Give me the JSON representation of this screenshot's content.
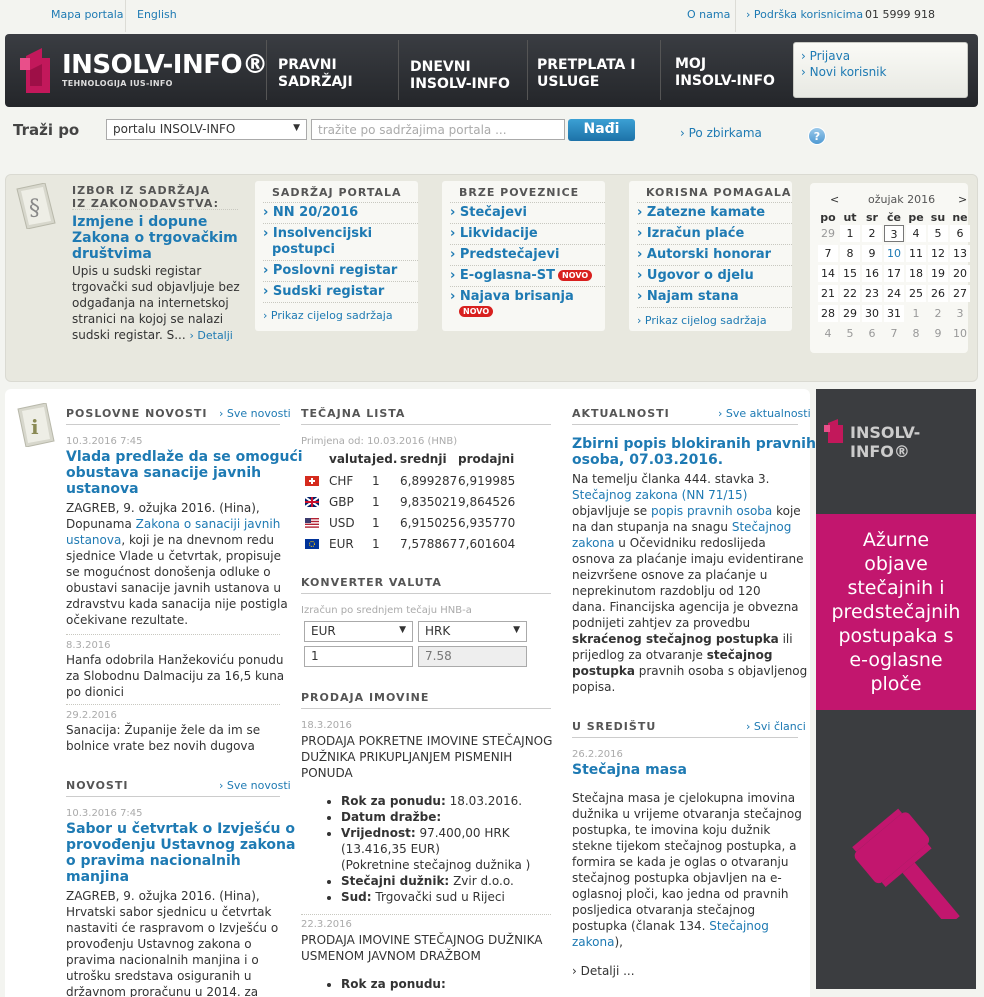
{
  "topbar": {
    "map": "Mapa portala",
    "english": "English",
    "about": "O nama",
    "support": "› Podrška korisnicima",
    "phone": "01 5999 918"
  },
  "logo": {
    "name": "INSOLV-INFO®",
    "tagline": "TEHNOLOGIJA IUS-INFO"
  },
  "nav": [
    [
      "PRAVNI",
      "SADRŽAJI"
    ],
    [
      "DNEVNI",
      "INSOLV-INFO"
    ],
    [
      "PRETPLATA I",
      "USLUGE"
    ],
    [
      "MOJ",
      "INSOLV-INFO"
    ]
  ],
  "login": {
    "signin": "› Prijava",
    "new_user": "› Novi korisnik"
  },
  "search": {
    "label": "Traži po",
    "scope": "portalu INSOLV-INFO",
    "placeholder": "tražite po sadržajima portala ...",
    "button": "Nađi",
    "collections": "› Po zbirkama",
    "help": "?"
  },
  "featured": {
    "head1": "IZBOR IZ SADRŽAJA",
    "head2": "IZ ZAKONODAVSTVA:",
    "title": [
      "Izmjene i dopune",
      "Zakona o trgovačkim",
      "društvima"
    ],
    "text": [
      "Upis u sudski registar",
      "trgovački sud objavljuje bez",
      "odgađanja na internetskoj",
      "stranici na kojoj se nalazi",
      "sudski registar. S..."
    ],
    "more": "› Detalji"
  },
  "portal": {
    "head": "SADRŽAJ PORTALA",
    "items": [
      "NN 20/2016",
      "Insolvencijski",
      "postupci",
      "Poslovni registar",
      "Sudski registar"
    ],
    "all": "› Prikaz cijelog sadržaja"
  },
  "quick": {
    "head": "BRZE POVEZNICE",
    "items": [
      "Stečajevi",
      "Likvidacije",
      "Predstečajevi",
      "E-oglasna-ST",
      "Najava brisanja"
    ],
    "novo": "NOVO"
  },
  "tools": {
    "head": "KORISNA POMAGALA",
    "items": [
      "Zatezne kamate",
      "Izračun plaće",
      "Autorski honorar",
      "Ugovor o djelu",
      "Najam stana"
    ],
    "all": "› Prikaz cijelog sadržaja"
  },
  "calendar": {
    "prev": "<",
    "month": "ožujak",
    "year": "2016",
    "next": ">",
    "days": [
      "po",
      "ut",
      "sr",
      "če",
      "pe",
      "su",
      "ne"
    ],
    "weeks": [
      [
        "29",
        "1",
        "2",
        "3",
        "4",
        "5",
        "6"
      ],
      [
        "7",
        "8",
        "9",
        "10",
        "11",
        "12",
        "13"
      ],
      [
        "14",
        "15",
        "16",
        "17",
        "18",
        "19",
        "20"
      ],
      [
        "21",
        "22",
        "23",
        "24",
        "25",
        "26",
        "27"
      ],
      [
        "28",
        "29",
        "30",
        "31",
        "1",
        "2",
        "3"
      ],
      [
        "4",
        "5",
        "6",
        "7",
        "8",
        "9",
        "10"
      ]
    ]
  },
  "business": {
    "head": "POSLOVNE NOVOSTI",
    "all": "› Sve novosti",
    "n1": {
      "date": "10.3.2016 7:45",
      "title": [
        "Vlada predlaže da se omogući",
        "obustava sanacije javnih",
        "ustanova"
      ],
      "text": [
        "ZAGREB, 9. ožujka 2016. (Hina),",
        "Dopunama ",
        "Zakona o sanaciji javnih",
        "ustanova",
        ", koji je na dnevnom redu",
        "sjednice Vlade u četvrtak, propisuje",
        "se mogućnost donošenja odluke o",
        "obustavi sanacije javnih ustanova u",
        "zdravstvu kada sanacija nije postigla",
        "očekivane rezultate."
      ]
    },
    "n2": {
      "date": "8.3.2016",
      "title": [
        "Hanfa odobrila Hanžekoviću ponudu",
        "za Slobodnu Dalmaciju za 16,5 kuna",
        "po dionici"
      ]
    },
    "n3": {
      "date": "29.2.2016",
      "title": [
        "Sanacija: Županije žele da im se",
        "bolnice vrate bez novih dugova"
      ]
    }
  },
  "news": {
    "head": "NOVOSTI",
    "all": "› Sve novosti",
    "n1": {
      "date": "10.3.2016 7:45",
      "title": [
        "Sabor u četvrtak o Izvješću o",
        "provođenju Ustavnog zakona",
        "o pravima nacionalnih",
        "manjina"
      ],
      "text": [
        "ZAGREB, 9. ožujka 2016. (Hina),",
        "Hrvatski sabor sjednicu u četvrtak",
        "nastaviti će raspravom o Izvješću o",
        "provođenju Ustavnog zakona o",
        "pravima nacionalnih manjina i o",
        "utrošku sredstava osiguranih u",
        "državnom proračunu u 2014. za"
      ]
    }
  },
  "rates": {
    "head": "TEČAJNA LISTA",
    "applies": "Primjena od: 10.03.2016 (HNB)",
    "cols": [
      "valuta",
      "jed.",
      "srednji",
      "prodajni"
    ],
    "rows": [
      [
        "CHF",
        "1",
        "6,899287",
        "6,919985"
      ],
      [
        "GBP",
        "1",
        "9,835021",
        "9,864526"
      ],
      [
        "USD",
        "1",
        "6,915025",
        "6,935770"
      ],
      [
        "EUR",
        "1",
        "7,578867",
        "7,601604"
      ]
    ]
  },
  "converter": {
    "head": "KONVERTER VALUTA",
    "note": "Izračun po srednjem tečaju HNB-a",
    "from": "EUR",
    "to": "HRK",
    "amount": "1",
    "result": "7.58"
  },
  "sales": {
    "head": "PRODAJA IMOVINE",
    "s1": {
      "date": "18.3.2016",
      "title": [
        "PRODAJA POKRETNE IMOVINE STEČAJNOG",
        "DUŽNIKA PRIKUPLJANJEM PISMENIH",
        "PONUDA"
      ],
      "deadline_label": "Rok za ponudu:",
      "deadline": "18.03.2016.",
      "date_label": "Datum dražbe:",
      "value_label": "Vrijednost:",
      "value": "97.400,00 HRK",
      "value2": "(13.416,35 EUR)",
      "value3": "(Pokretnine stečajnog dužnika )",
      "debtor_label": "Stečajni dužnik:",
      "debtor": "Zvir d.o.o.",
      "court_label": "Sud:",
      "court": "Trgovački sud u Rijeci"
    },
    "s2": {
      "date": "22.3.2016",
      "title": [
        "PRODAJA IMOVINE STEČAJNOG DUŽNIKA",
        "USMENOM JAVNOM DRAŽBOM"
      ],
      "deadline_label": "Rok za ponudu:"
    }
  },
  "actual": {
    "head": "AKTUALNOSTI",
    "all": "› Sve aktualnosti",
    "title": [
      "Zbirni popis blokiranih pravnih",
      "osoba, 07.03.2016."
    ],
    "lines": [
      "Na temelju članka 444. stavka 3.",
      "Stečajnog zakona (NN 71/15)",
      "objavljuje se ",
      "popis pravnih osoba",
      " koje",
      "na dan stupanja na snagu ",
      "Stečajnog",
      "zakona",
      " u Očevidniku redoslijeda",
      "osnova za plaćanje imaju evidentirane",
      "neizvršene osnove za plaćanje u",
      "neprekinutom razdoblju od 120",
      "dana. Financijska agencija je obvezna",
      "podnijeti zahtjev za provedbu",
      "skraćenog stečajnog postupka",
      " ili",
      "prijedlog za otvaranje ",
      "stečajnog",
      "postupka",
      " pravnih osoba s objavljenog",
      "popisa."
    ]
  },
  "focus": {
    "head": "U SREDIŠTU",
    "all": "› Svi članci",
    "date": "26.2.2016",
    "title": "Stečajna masa",
    "lines": [
      "Stečajna masa je cjelokupna imovina",
      "dužnika u vrijeme otvaranja stečajnog",
      "postupka, te imovina koju dužnik",
      "stekne tijekom stečajnog postupka, a",
      "formira se kada je oglas o otvaranju",
      "stečajnog postupka objavljen na e-",
      "oglasnoj ploči, kao jedna od pravnih",
      "posljedica otvaranja stečajnog",
      "postupka (članak 134. ",
      "Stečajnog",
      "zakona",
      "),"
    ],
    "more": "› Detalji ..."
  },
  "ad": {
    "brand": "INSOLV-INFO®",
    "lines": [
      "Ažurne",
      "objave",
      "stečajnih i",
      "predstečajnih",
      "postupaka s",
      "e-oglasne",
      "ploče"
    ]
  },
  "colors": {
    "accent": "#1e7ab3",
    "brand": "#c2185b",
    "header": "#2d3035"
  }
}
